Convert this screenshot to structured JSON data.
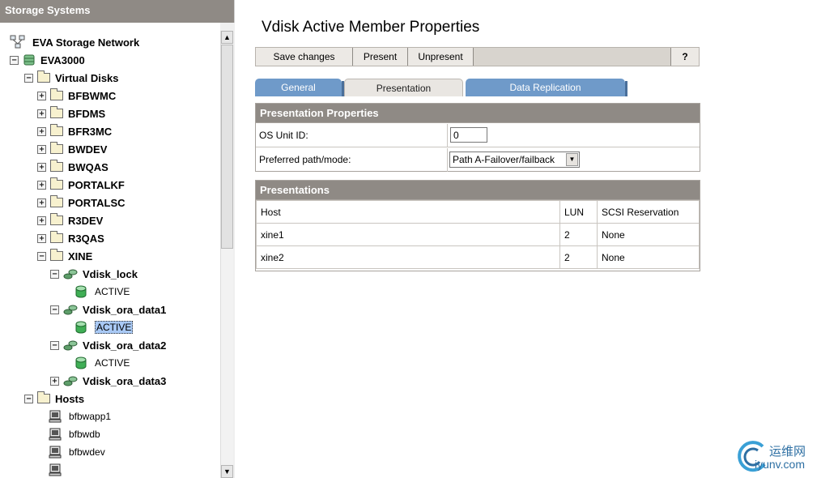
{
  "left_panel": {
    "header": "Storage Systems",
    "tree": {
      "network": "EVA Storage Network",
      "system": "EVA3000",
      "virtual_disks": "Virtual Disks",
      "folders": [
        "BFBWMC",
        "BFDMS",
        "BFR3MC",
        "BWDEV",
        "BWQAS",
        "PORTALKF",
        "PORTALSC",
        "R3DEV",
        "R3QAS",
        "XINE"
      ],
      "vdisks": [
        {
          "name": "Vdisk_lock",
          "member": "ACTIVE",
          "expanded": true
        },
        {
          "name": "Vdisk_ora_data1",
          "member": "ACTIVE",
          "expanded": true,
          "selected": true
        },
        {
          "name": "Vdisk_ora_data2",
          "member": "ACTIVE",
          "expanded": true
        },
        {
          "name": "Vdisk_ora_data3",
          "expanded": false
        }
      ],
      "hosts": "Hosts",
      "host_items": [
        "bfbwapp1",
        "bfbwdb",
        "bfbwdev"
      ]
    }
  },
  "page_title": "Vdisk Active Member Properties",
  "toolbar": {
    "save_label": "Save changes",
    "present_label": "Present",
    "unpresent_label": "Unpresent",
    "help_label": "?"
  },
  "tabs": [
    {
      "label": "General",
      "active": false
    },
    {
      "label": "Presentation",
      "active": true
    },
    {
      "label": "Data Replication",
      "active": false
    }
  ],
  "presentation_properties": {
    "title": "Presentation Properties",
    "os_unit_label": "OS Unit ID:",
    "os_unit_value": "0",
    "preferred_path_label": "Preferred path/mode:",
    "preferred_path_value": "Path A-Failover/failback"
  },
  "presentations": {
    "title": "Presentations",
    "columns": [
      "Host",
      "LUN",
      "SCSI Reservation"
    ],
    "rows": [
      [
        "xine1",
        "2",
        "None"
      ],
      [
        "xine2",
        "2",
        "None"
      ]
    ]
  },
  "watermark": {
    "cn": "运维网",
    "en": "iyunv.com"
  },
  "colors": {
    "header_gray": "#8f8a85",
    "tab_blue": "#6f9ac9",
    "selection": "#a9c9f5"
  }
}
